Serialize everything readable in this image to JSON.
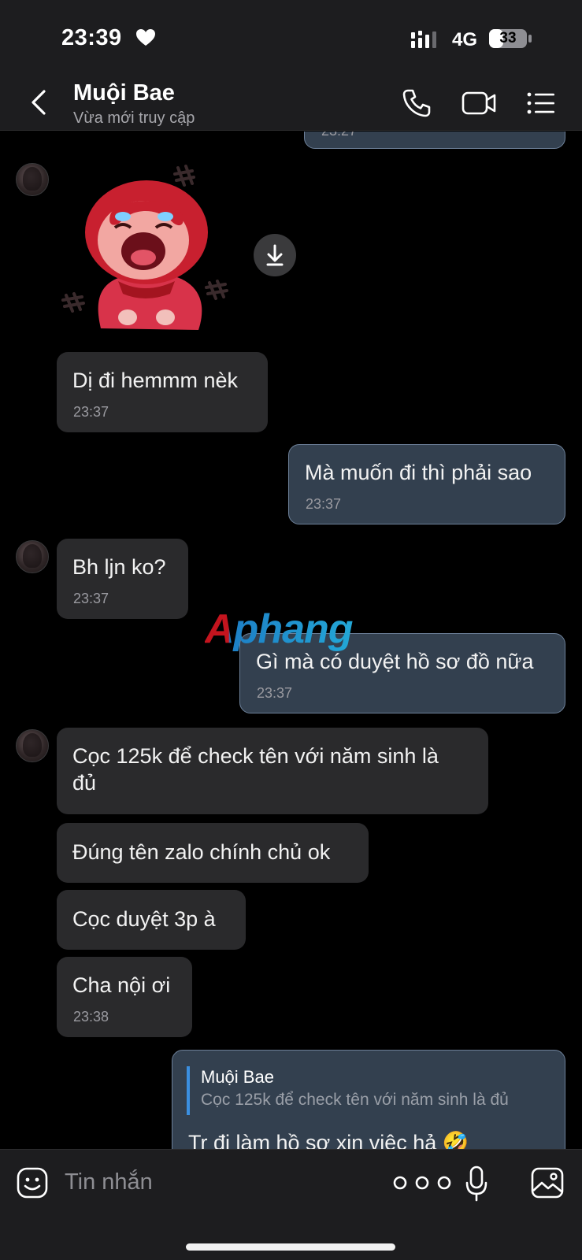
{
  "status_bar": {
    "time": "23:39",
    "network": "4G",
    "battery": "33"
  },
  "header": {
    "contact_name": "Muội Bae",
    "contact_status": "Vừa mới truy cập",
    "icons": [
      "back-icon",
      "phone-icon",
      "video-icon",
      "menu-icon"
    ]
  },
  "chat": {
    "top_partial_time": "23:27",
    "messages": [
      {
        "text": "Dị đi hemmm nèk",
        "time": "23:37"
      },
      {
        "text": "Mà muốn đi thì phải sao",
        "time": "23:37"
      },
      {
        "text": "Bh ljn ko?",
        "time": "23:37"
      },
      {
        "text": "Gì mà có duyệt hồ sơ đồ nữa",
        "time": "23:37"
      },
      {
        "line1": "Cọc 125k để check tên với năm sinh là",
        "line2": "đủ"
      },
      {
        "text": "Đúng tên zalo chính chủ ok"
      },
      {
        "text": "Cọc duyệt 3p à"
      },
      {
        "text": "Cha nội ơi",
        "time": "23:38"
      },
      {
        "quote_name": "Muội Bae",
        "quote_text": "Cọc 125k để check tên với năm sinh là đủ",
        "text": "Tr đi làm hồ sơ xin việc hả 🤣"
      }
    ]
  },
  "watermark": "Aphang",
  "colors": {
    "background": "#000000",
    "bar": "#1d1d1f",
    "received_bubble": "#2a2a2c",
    "sent_bubble": "#33404f",
    "sent_border": "#6d8099",
    "quote_accent": "#3b8fe0"
  },
  "input_bar": {
    "placeholder": "Tin nhắn",
    "icons": [
      "sticker-icon",
      "more-icon",
      "mic-icon",
      "image-icon"
    ]
  }
}
